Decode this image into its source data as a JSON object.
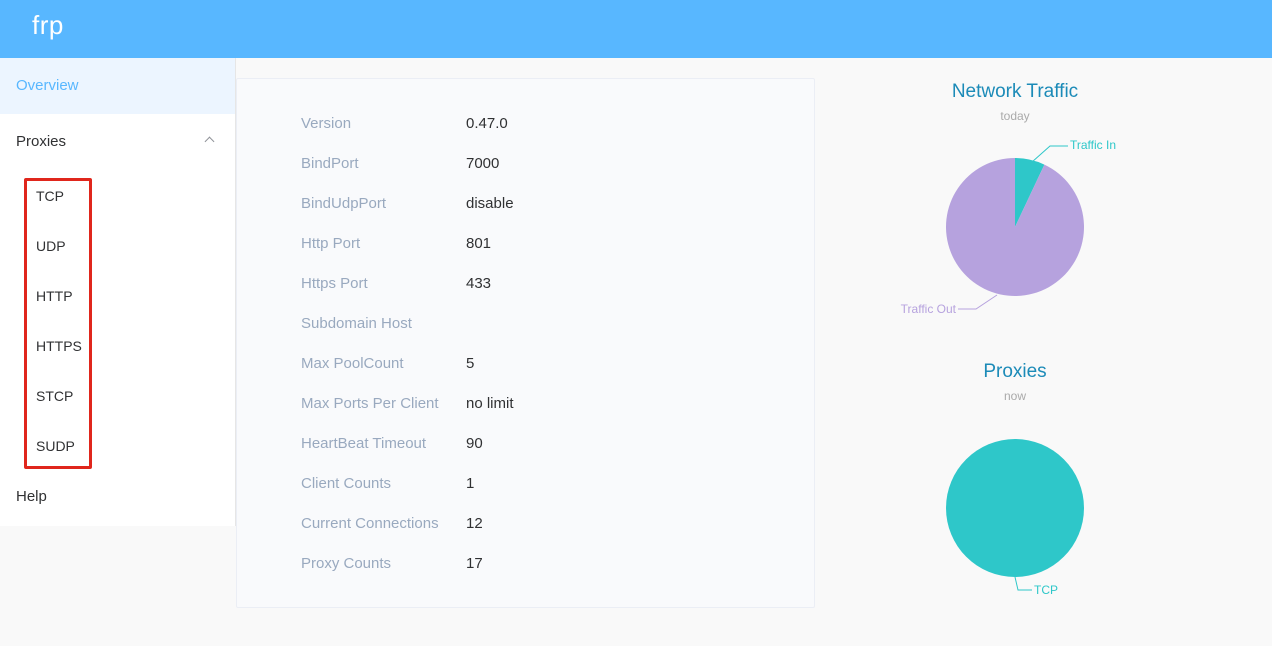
{
  "header": {
    "brand": "frp"
  },
  "sidebar": {
    "overview": "Overview",
    "proxies": "Proxies",
    "proxy_types": [
      "TCP",
      "UDP",
      "HTTP",
      "HTTPS",
      "STCP",
      "SUDP"
    ],
    "help": "Help"
  },
  "server_info": [
    {
      "label": "Version",
      "value": "0.47.0"
    },
    {
      "label": "BindPort",
      "value": "7000"
    },
    {
      "label": "BindUdpPort",
      "value": "disable"
    },
    {
      "label": "Http Port",
      "value": "801"
    },
    {
      "label": "Https Port",
      "value": "433"
    },
    {
      "label": "Subdomain Host",
      "value": ""
    },
    {
      "label": "Max PoolCount",
      "value": "5"
    },
    {
      "label": "Max Ports Per Client",
      "value": "no limit"
    },
    {
      "label": "HeartBeat Timeout",
      "value": "90"
    },
    {
      "label": "Client Counts",
      "value": "1"
    },
    {
      "label": "Current Connections",
      "value": "12"
    },
    {
      "label": "Proxy Counts",
      "value": "17"
    }
  ],
  "colors": {
    "header": "#58b7ff",
    "traffic_in": "#2ec7c9",
    "traffic_out": "#b6a2de",
    "tcp": "#2ec7c9",
    "highlight": "#e0261c"
  },
  "chart_data": [
    {
      "type": "pie",
      "title": "Network Traffic",
      "subtitle": "today",
      "categories": [
        "Traffic In",
        "Traffic Out"
      ],
      "values": [
        7,
        93
      ]
    },
    {
      "type": "pie",
      "title": "Proxies",
      "subtitle": "now",
      "categories": [
        "TCP"
      ],
      "values": [
        100
      ]
    }
  ]
}
